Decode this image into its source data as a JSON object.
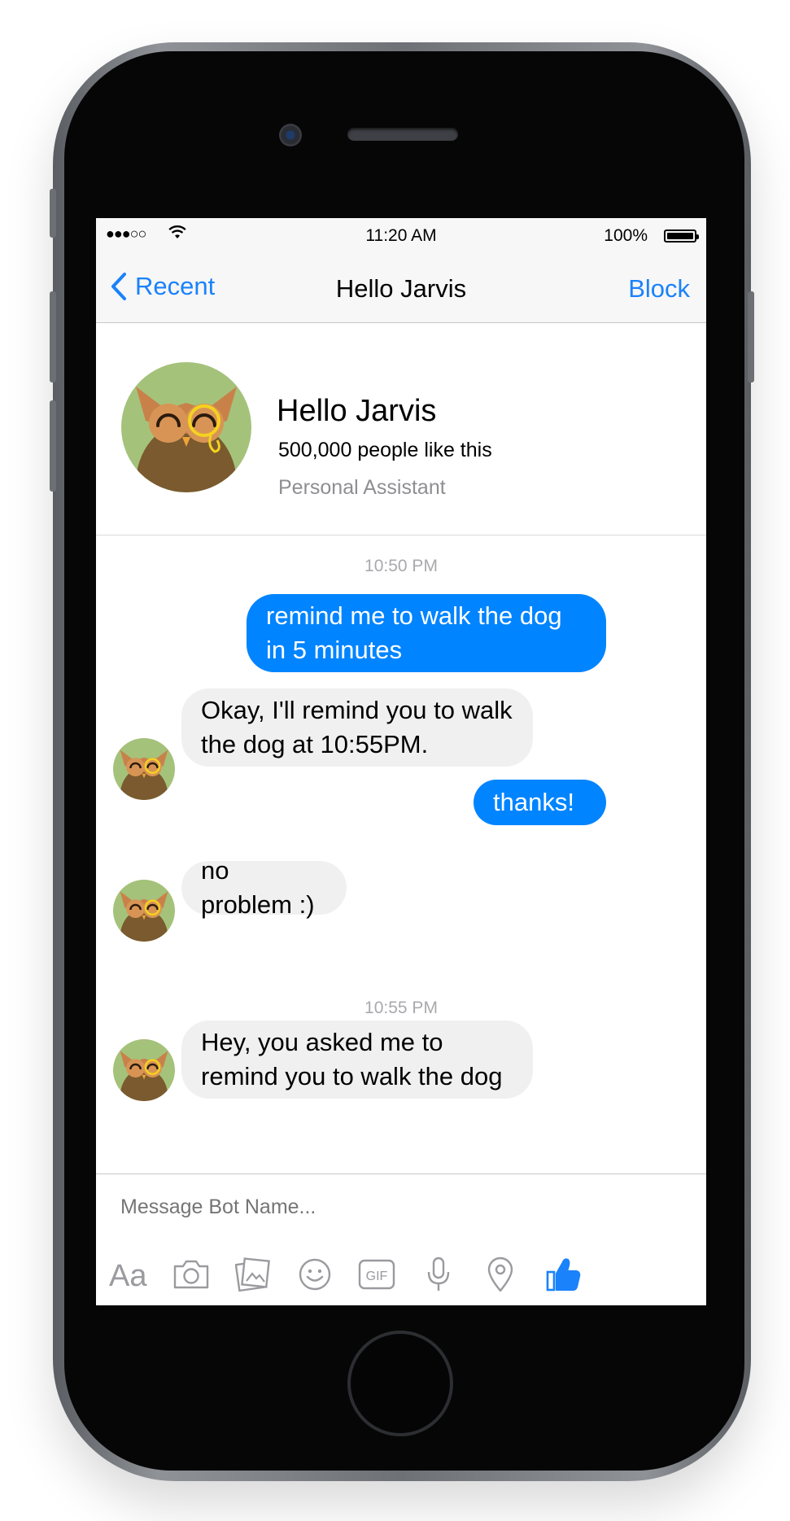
{
  "status_bar": {
    "signal": "●●●○○",
    "time": "11:20 AM",
    "battery": "100%"
  },
  "nav": {
    "back_label": "Recent",
    "title": "Hello Jarvis",
    "action_label": "Block"
  },
  "profile": {
    "name": "Hello Jarvis",
    "likes": "500,000 people like this",
    "category": "Personal Assistant"
  },
  "conversation": {
    "timestamps": [
      "10:50 PM",
      "10:55 PM"
    ],
    "messages": [
      {
        "sender": "user",
        "text": "remind me to walk the dog in 5 minutes"
      },
      {
        "sender": "bot",
        "text": "Okay, I'll remind you to walk the dog at 10:55PM."
      },
      {
        "sender": "user",
        "text": "thanks!"
      },
      {
        "sender": "bot",
        "text": "no problem :)"
      },
      {
        "sender": "bot",
        "text": "Hey, you asked me to remind you to walk the dog"
      }
    ]
  },
  "composer": {
    "placeholder": "Message Bot Name...",
    "tools": [
      "text-format-icon",
      "camera-icon",
      "photo-gallery-icon",
      "emoji-icon",
      "gif-icon",
      "microphone-icon",
      "location-icon",
      "thumbs-up-icon"
    ],
    "like_color": "#1a82fb",
    "tool_color": "#9a9a9f"
  },
  "colors": {
    "accent": "#1a82fb",
    "outgoing_bubble": "#0084ff",
    "incoming_bubble": "#f1f0f0"
  }
}
